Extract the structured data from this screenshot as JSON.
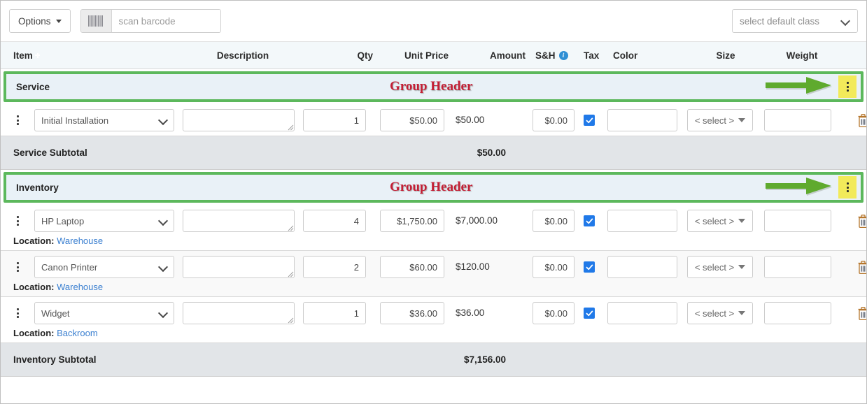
{
  "toolbar": {
    "options_label": "Options",
    "barcode_icon": "barcode-icon",
    "barcode_placeholder": "scan barcode",
    "barcode_value": "",
    "default_class_label": "select default class"
  },
  "columns": {
    "item": "Item",
    "description": "Description",
    "qty": "Qty",
    "unit_price": "Unit Price",
    "amount": "Amount",
    "sh": "S&H",
    "sh_info_icon": "info-icon",
    "tax": "Tax",
    "color": "Color",
    "size": "Size",
    "weight": "Weight",
    "add_item_icon": "plus-square-icon"
  },
  "annotations": {
    "group_header_text": "Group Header",
    "arrow_icon": "right-arrow-icon",
    "highlight_color": "#f2ea5a",
    "arrow_color": "#5faa2e",
    "outline_color": "#5cb85c",
    "annotation_color": "#c41f35"
  },
  "groups": [
    {
      "title": "Service",
      "menu_icon": "kebab-menu-icon",
      "rows": [
        {
          "handle_icon": "kebab-menu-icon",
          "item": "Initial Installation",
          "description": "",
          "qty": "1",
          "unit_price": "$50.00",
          "amount": "$50.00",
          "sh": "$0.00",
          "tax_checked": true,
          "color": "",
          "size": "< select >",
          "weight": "",
          "delete_icon": "trash-icon",
          "location_label": "",
          "location_value": ""
        }
      ],
      "subtotal_label": "Service Subtotal",
      "subtotal_value": "$50.00"
    },
    {
      "title": "Inventory",
      "menu_icon": "kebab-menu-icon",
      "rows": [
        {
          "handle_icon": "kebab-menu-icon",
          "item": "HP Laptop",
          "description": "",
          "qty": "4",
          "unit_price": "$1,750.00",
          "amount": "$7,000.00",
          "sh": "$0.00",
          "tax_checked": true,
          "color": "",
          "size": "< select >",
          "weight": "",
          "delete_icon": "trash-icon",
          "location_label": "Location:",
          "location_value": "Warehouse"
        },
        {
          "handle_icon": "kebab-menu-icon",
          "item": "Canon Printer",
          "description": "",
          "qty": "2",
          "unit_price": "$60.00",
          "amount": "$120.00",
          "sh": "$0.00",
          "tax_checked": true,
          "color": "",
          "size": "< select >",
          "weight": "",
          "delete_icon": "trash-icon",
          "location_label": "Location:",
          "location_value": "Warehouse"
        },
        {
          "handle_icon": "kebab-menu-icon",
          "item": "Widget",
          "description": "",
          "qty": "1",
          "unit_price": "$36.00",
          "amount": "$36.00",
          "sh": "$0.00",
          "tax_checked": true,
          "color": "",
          "size": "< select >",
          "weight": "",
          "delete_icon": "trash-icon",
          "location_label": "Location:",
          "location_value": "Backroom"
        }
      ],
      "subtotal_label": "Inventory Subtotal",
      "subtotal_value": "$7,156.00"
    }
  ]
}
